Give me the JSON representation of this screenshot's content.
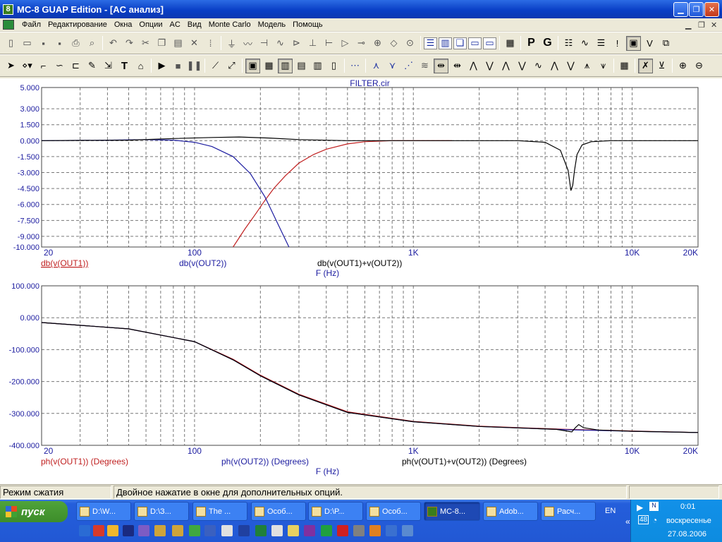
{
  "window": {
    "title": "MC-8 GUAP Edition - [AC анализ]",
    "logo": "8"
  },
  "menu": [
    "Файл",
    "Редактирование",
    "Окна",
    "Опции",
    "AC",
    "Вид",
    "Monte Carlo",
    "Модель",
    "Помощь"
  ],
  "toolbar2_letters": {
    "p": "P",
    "g": "G"
  },
  "chart_data": [
    {
      "type": "line",
      "title": "FILTER.cir",
      "x_scale": "log",
      "xlim": [
        20,
        20000
      ],
      "x_ticks": [
        "20",
        "100",
        "1K",
        "10K",
        "20K"
      ],
      "ylim": [
        -10,
        5
      ],
      "y_ticks": [
        "5.000",
        "3.000",
        "1.500",
        "0.000",
        "-1.500",
        "-3.000",
        "-4.500",
        "-6.000",
        "-7.500",
        "-9.000",
        "-10.000"
      ],
      "xlabel": "F (Hz)",
      "legend": [
        "db(v(OUT1))",
        "db(v(OUT2))",
        "db(v(OUT1)+v(OUT2))"
      ],
      "series": [
        {
          "name": "db(v(OUT1))",
          "color": "#c02020",
          "x": [
            150,
            170,
            190,
            210,
            230,
            260,
            300,
            350,
            400,
            500,
            600,
            800,
            1000,
            1500
          ],
          "y": [
            -10,
            -8.3,
            -6.9,
            -5.6,
            -4.5,
            -3.3,
            -2.1,
            -1.3,
            -0.8,
            -0.3,
            -0.1,
            0,
            0,
            0
          ]
        },
        {
          "name": "db(v(OUT2))",
          "color": "#1c1ca0",
          "x": [
            20,
            40,
            60,
            80,
            100,
            120,
            150,
            180,
            210,
            240,
            270
          ],
          "y": [
            0,
            0.05,
            0.1,
            0.05,
            -0.15,
            -0.55,
            -1.5,
            -3.1,
            -5.3,
            -7.8,
            -10
          ]
        },
        {
          "name": "db(v(OUT1)+v(OUT2))",
          "color": "#000000",
          "x": [
            20,
            50,
            80,
            120,
            160,
            220,
            300,
            500,
            1000,
            2000,
            3000,
            4000,
            4700,
            5100,
            5250,
            5350,
            5450,
            5600,
            5900,
            6500,
            8000,
            20000
          ],
          "y": [
            0,
            0.05,
            0.2,
            0.3,
            0.35,
            0.25,
            0.1,
            0,
            0,
            0,
            0,
            -0.15,
            -0.9,
            -2.8,
            -4.7,
            -4.2,
            -2.8,
            -1.3,
            -0.4,
            -0.1,
            0,
            0
          ]
        }
      ]
    },
    {
      "type": "line",
      "x_scale": "log",
      "xlim": [
        20,
        20000
      ],
      "x_ticks": [
        "20",
        "100",
        "1K",
        "10K",
        "20K"
      ],
      "ylim": [
        -400,
        100
      ],
      "y_ticks": [
        "100.000",
        "0.000",
        "-100.000",
        "-200.000",
        "-300.000",
        "-400.000"
      ],
      "xlabel": "F (Hz)",
      "legend": [
        "ph(v(OUT1)) (Degrees)",
        "ph(v(OUT2)) (Degrees)",
        "ph(v(OUT1)+v(OUT2)) (Degrees)"
      ],
      "series": [
        {
          "name": "ph(v(OUT1)) (Degrees)",
          "color": "#c02020",
          "x": [
            20,
            50,
            100,
            150,
            200,
            300,
            500,
            1000,
            2000,
            5000,
            10000,
            20000
          ],
          "y": [
            -15,
            -35,
            -75,
            -130,
            -180,
            -240,
            -295,
            -325,
            -340,
            -350,
            -355,
            -360
          ]
        },
        {
          "name": "ph(v(OUT2)) (Degrees)",
          "color": "#1c1ca0",
          "x": [
            20,
            50,
            100,
            150,
            200,
            300,
            500,
            1000,
            2000,
            5000,
            10000,
            20000
          ],
          "y": [
            -15,
            -35,
            -75,
            -132,
            -182,
            -242,
            -297,
            -326,
            -341,
            -351,
            -356,
            -360
          ]
        },
        {
          "name": "ph(v(OUT1)+v(OUT2)) (Degrees)",
          "color": "#000000",
          "x": [
            20,
            50,
            100,
            150,
            200,
            300,
            500,
            1000,
            2000,
            4500,
            5300,
            5500,
            5700,
            6000,
            7000,
            10000,
            20000
          ],
          "y": [
            -15,
            -35,
            -75,
            -132,
            -182,
            -242,
            -297,
            -326,
            -341,
            -350,
            -358,
            -345,
            -335,
            -345,
            -352,
            -356,
            -360
          ]
        }
      ]
    }
  ],
  "status": {
    "left": "Режим сжатия",
    "right": "Двойное нажатие в окне для дополнительных опций."
  },
  "taskbar": {
    "start": "пуск",
    "tasks": [
      "D:\\W...",
      "D:\\З...",
      "The ...",
      "Особ...",
      "D:\\Р...",
      "Особ...",
      "MC-8...",
      "Adob...",
      "Расч..."
    ],
    "lang": "EN",
    "time": "0:01",
    "day": "воскресенье",
    "date": "27.08.2006",
    "tray_num": "48"
  }
}
